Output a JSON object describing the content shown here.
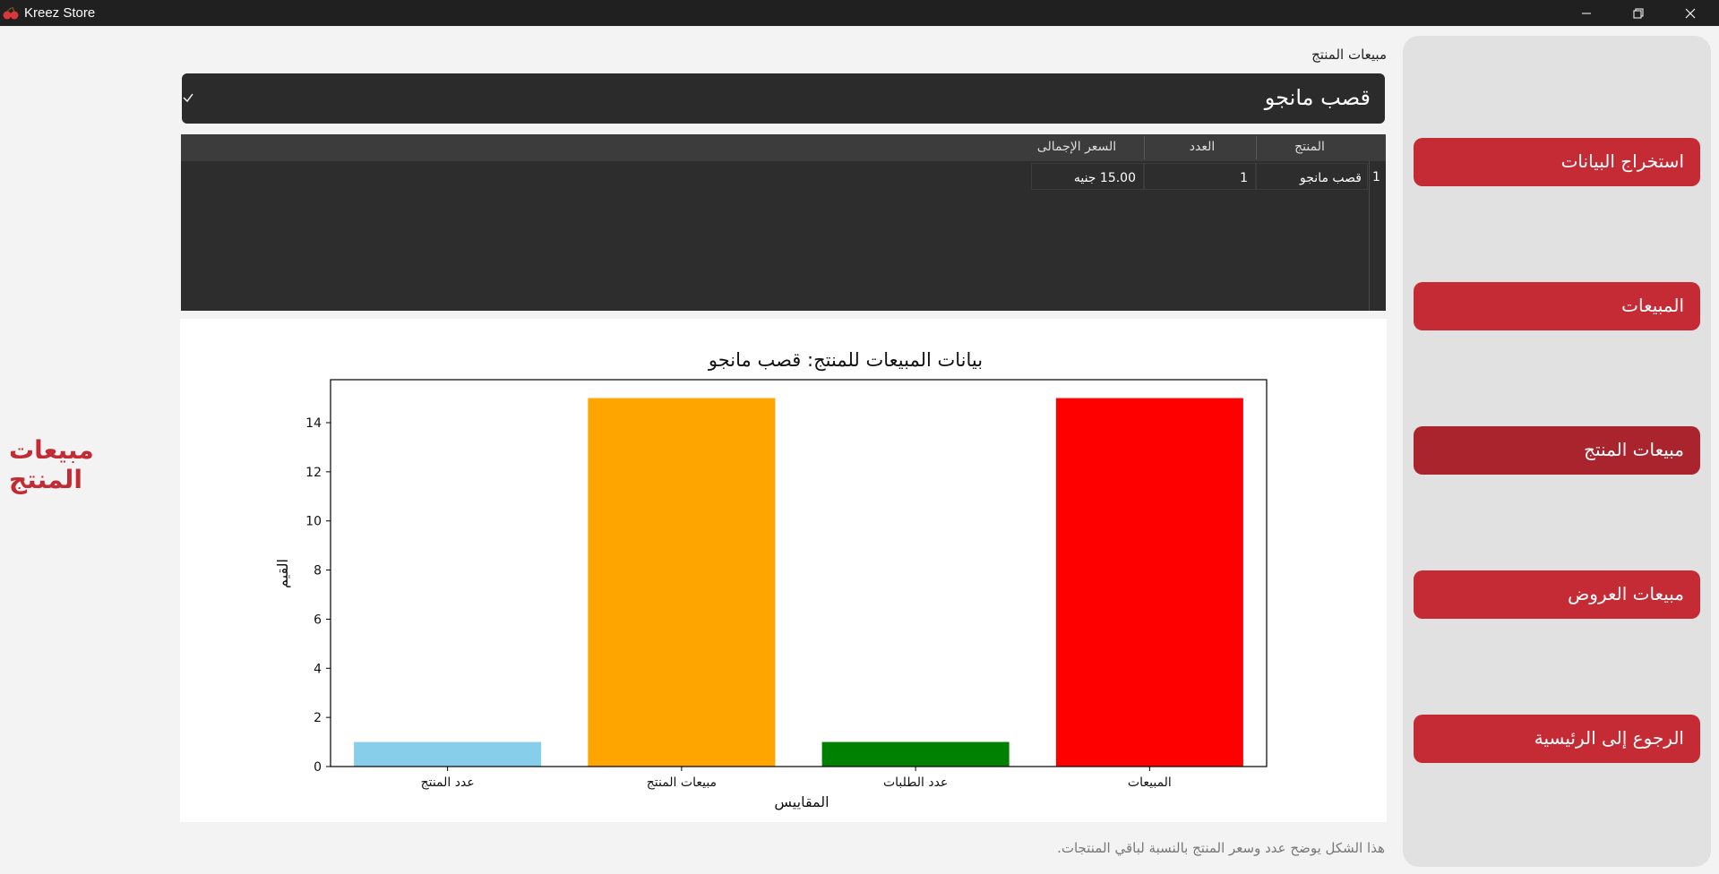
{
  "window": {
    "title": "Kreez Store",
    "controls": [
      "minimize",
      "restore",
      "close"
    ]
  },
  "page_heading": "مبيعات المنتج",
  "product_selector": {
    "label": "مبيعات المنتج",
    "selected_value": "قصب مانجو"
  },
  "sales_table": {
    "columns": [
      "المنتج",
      "العدد",
      "السعر الإجمالى"
    ],
    "rows": [
      {
        "row_number": "1",
        "product": "قصب مانجو",
        "count": "1",
        "total_price": "15.00 جنيه"
      }
    ]
  },
  "chart_data": {
    "type": "bar",
    "title": "بيانات المبيعات للمنتج: قصب مانجو",
    "xlabel": "المقاييس",
    "ylabel": "القيم",
    "categories": [
      "عدد المنتج",
      "مبيعات المنتج",
      "عدد الطلبات",
      "المبيعات"
    ],
    "values": [
      1,
      15,
      1,
      15
    ],
    "colors": [
      "#87ceeb",
      "#ffa500",
      "#008000",
      "#ff0000"
    ],
    "ylim": [
      0,
      15.75
    ],
    "yticks": [
      0,
      2,
      4,
      6,
      8,
      10,
      12,
      14
    ],
    "grid": false
  },
  "caption": "هذا الشكل يوضح عدد وسعر المنتج بالنسبة لباقي المنتجات.",
  "sidebar": {
    "items": [
      {
        "label": "استخراج البيانات",
        "active": false
      },
      {
        "label": "المبيعات",
        "active": false
      },
      {
        "label": "مبيعات المنتج",
        "active": true
      },
      {
        "label": "مبيعات العروض",
        "active": false
      },
      {
        "label": "الرجوع إلى الرئيسية",
        "active": false
      }
    ]
  },
  "colors": {
    "accent": "#c52b34",
    "accent_active": "#a9242c",
    "titlebar": "#202020",
    "dark_panel": "#2b2b2b"
  }
}
